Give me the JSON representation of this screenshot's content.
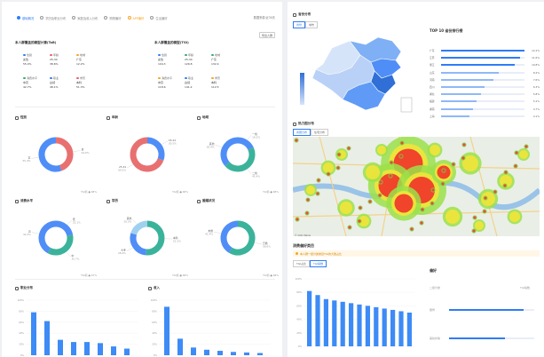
{
  "tabs": [
    {
      "label": "基础概况",
      "active": true
    },
    {
      "label": "学历及职业分布",
      "active": false
    },
    {
      "label": "家庭及收入分布",
      "active": false
    },
    {
      "label": "购物偏好",
      "active": false
    },
    {
      "label": "APP偏好",
      "active": false
    },
    {
      "label": "生活偏好",
      "active": false
    }
  ],
  "header_note": "数据来源:近30天",
  "export_label": "导出人群",
  "overview": {
    "left_title": "本人群覆盖的模型计算(ToB)",
    "right_title": "本人群覆盖的模型(TGI)",
    "left_metrics": [
      {
        "label": "性别",
        "color": "#2f7cf6",
        "v1": "女性",
        "v2": "55.4%"
      },
      {
        "label": "年龄",
        "color": "#e85d75",
        "v1": "25-34",
        "v2": "38.6%"
      },
      {
        "label": "地域",
        "color": "#f5a623",
        "v1": "广东",
        "v2": "12.2%"
      },
      {
        "label": "消费水平",
        "color": "#3aa870",
        "v1": "中高",
        "v2": "42.7%"
      },
      {
        "label": "职业",
        "color": "#2f7cf6",
        "v1": "白领",
        "v2": "48.1%"
      },
      {
        "label": "学历",
        "color": "#e85d75",
        "v1": "本科",
        "v2": "51.3%"
      }
    ],
    "right_metrics": [
      {
        "label": "性别",
        "color": "#2f7cf6",
        "v1": "女性",
        "v2": "104.3"
      },
      {
        "label": "年龄",
        "color": "#3aa870",
        "v1": "25-34",
        "v2": "126.8"
      },
      {
        "label": "地域",
        "color": "#3aa870",
        "v1": "广东",
        "v2": "132.4"
      },
      {
        "label": "消费水平",
        "color": "#f5a623",
        "v1": "中高",
        "v2": "118.6"
      },
      {
        "label": "职业",
        "color": "#2f7cf6",
        "v1": "白领",
        "v2": "141.2"
      },
      {
        "label": "学历",
        "color": "#f5a623",
        "v1": "本科",
        "v2": "112.5"
      }
    ]
  },
  "donut_cards": [
    {
      "title": "性别",
      "slices": [
        {
          "name": "男",
          "value": 44.6,
          "color": "#e87070"
        },
        {
          "name": "女",
          "value": 55.4,
          "color": "#4f8ef7"
        }
      ],
      "footer": "TGI值 ● 68%"
    },
    {
      "title": "年龄",
      "slices": [
        {
          "name": "18-24",
          "value": 30.5,
          "color": "#4f8ef7"
        },
        {
          "name": "25-34",
          "value": 69.5,
          "color": "#e87070"
        }
      ],
      "footer": "TGI值 ● 68%"
    },
    {
      "title": "地域",
      "slices": [
        {
          "name": "一线",
          "value": 18.2,
          "color": "#4f8ef7"
        },
        {
          "name": "二线",
          "value": 45.4,
          "color": "#3bb39a"
        },
        {
          "name": "其他",
          "value": 36.4,
          "color": "#4f8ef7"
        }
      ],
      "footer": "TGI值 ● 68%"
    },
    {
      "title": "消费水平",
      "slices": [
        {
          "name": "低",
          "value": 22.1,
          "color": "#4f8ef7"
        },
        {
          "name": "中",
          "value": 35.7,
          "color": "#3bb39a"
        },
        {
          "name": "高",
          "value": 42.2,
          "color": "#4f8ef7"
        }
      ],
      "footer": "TGI值 ● 67%"
    },
    {
      "title": "学历",
      "slices": [
        {
          "name": "本科",
          "value": 51.3,
          "color": "#3bb39a"
        },
        {
          "name": "大专",
          "value": 28.4,
          "color": "#4f8ef7"
        },
        {
          "name": "其他",
          "value": 20.3,
          "color": "#9fd0f0"
        }
      ],
      "footer": "TGI值 ● 68%"
    },
    {
      "title": "婚姻状况",
      "slices": [
        {
          "name": "已婚",
          "value": 58.6,
          "color": "#3bb39a"
        },
        {
          "name": "未婚",
          "value": 41.4,
          "color": "#4f8ef7"
        }
      ],
      "footer": "TGI值 ● 68%"
    }
  ],
  "bar_cards_left": [
    {
      "title": "职业分布",
      "values": [
        78,
        62,
        28,
        24,
        24,
        22,
        16,
        12
      ]
    },
    {
      "title": "收入",
      "values": [
        88,
        30,
        14,
        10,
        8,
        6,
        5,
        4
      ]
    }
  ],
  "right_panel": {
    "map_title": "省份分布",
    "map_tabs": [
      "省份",
      "城市"
    ],
    "rank_title": "TOP 10 省份排行榜",
    "rank_rows": [
      {
        "name": "广东",
        "pct": 12.2
      },
      {
        "name": "江苏",
        "pct": 11.6
      },
      {
        "name": "浙江",
        "pct": 10.8
      },
      {
        "name": "山东",
        "pct": 8.4
      },
      {
        "name": "河南",
        "pct": 7.6
      },
      {
        "name": "四川",
        "pct": 6.3
      },
      {
        "name": "湖北",
        "pct": 5.8
      },
      {
        "name": "福建",
        "pct": 5.2
      },
      {
        "name": "湖南",
        "pct": 4.7
      },
      {
        "name": "上海",
        "pct": 4.1
      }
    ],
    "heat_title": "热力图分布",
    "heat_tabs": [
      "商圈分布",
      "住宅分布"
    ],
    "bar_title": "消费偏好类目",
    "warn_text": "本人群一级分类类目TGI的大致占比",
    "bar_tabs": [
      "TGI占比",
      "TGI指数"
    ],
    "bar_values": [
      82,
      76,
      70,
      68,
      66,
      64,
      62,
      60,
      58,
      56,
      54,
      52,
      50
    ],
    "side_title": "偏好",
    "side_labels": [
      "二级分类",
      "TGI指数"
    ],
    "side_rows": [
      {
        "label": "服饰",
        "pct": 88
      },
      {
        "label": "美妆护肤",
        "pct": 66
      }
    ]
  }
}
